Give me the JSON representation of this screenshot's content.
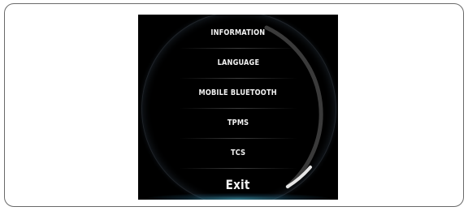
{
  "menu": {
    "items": [
      {
        "label": "INFORMATION"
      },
      {
        "label": "LANGUAGE"
      },
      {
        "label": "MOBILE BLUETOOTH"
      },
      {
        "label": "TPMS"
      },
      {
        "label": "TCS"
      },
      {
        "label": "Exit"
      }
    ]
  },
  "scroll_indicator": {
    "position": 0.95
  },
  "colors": {
    "screen_background": "#000000",
    "text": "#f2f2f2",
    "track": "#3a3a3a",
    "thumb": "#e6e6e6",
    "glow": "#50c8e6"
  }
}
